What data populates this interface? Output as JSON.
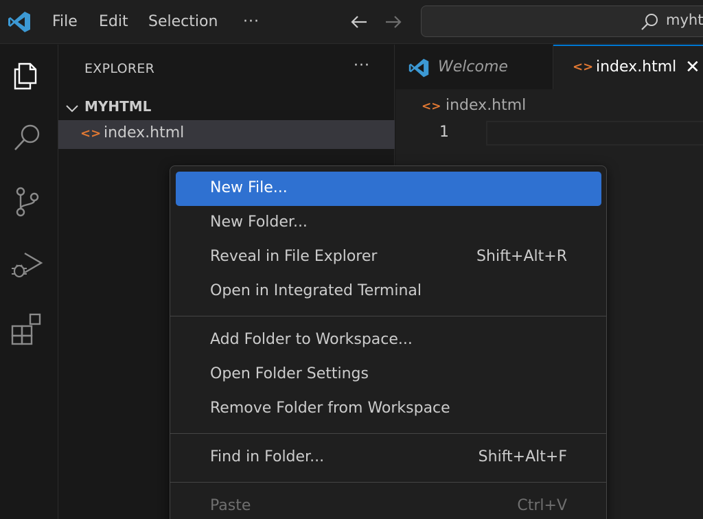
{
  "titlebar": {
    "menus": [
      "File",
      "Edit",
      "Selection"
    ],
    "more": "···",
    "search_text": "myhtml"
  },
  "sidebar": {
    "title": "EXPLORER",
    "more": "···",
    "folder": "MYHTML",
    "files": [
      {
        "icon": "<>",
        "name": "index.html"
      }
    ]
  },
  "editor": {
    "tabs": [
      {
        "label": "Welcome"
      },
      {
        "icon": "<>",
        "label": "index.html",
        "close": "✕"
      }
    ],
    "breadcrumb": {
      "icon": "<>",
      "label": "index.html"
    },
    "line_number": "1"
  },
  "context_menu": {
    "groups": [
      [
        {
          "label": "New File...",
          "shortcut": "",
          "active": true
        },
        {
          "label": "New Folder...",
          "shortcut": ""
        },
        {
          "label": "Reveal in File Explorer",
          "shortcut": "Shift+Alt+R"
        },
        {
          "label": "Open in Integrated Terminal",
          "shortcut": ""
        }
      ],
      [
        {
          "label": "Add Folder to Workspace...",
          "shortcut": ""
        },
        {
          "label": "Open Folder Settings",
          "shortcut": ""
        },
        {
          "label": "Remove Folder from Workspace",
          "shortcut": ""
        }
      ],
      [
        {
          "label": "Find in Folder...",
          "shortcut": "Shift+Alt+F"
        }
      ],
      [
        {
          "label": "Paste",
          "shortcut": "Ctrl+V",
          "disabled": true
        }
      ]
    ]
  },
  "colors": {
    "accent": "#0078d4",
    "menu_highlight": "#2f71d1",
    "html_icon": "#e37933",
    "vscode_blue": "#3c99d4"
  }
}
